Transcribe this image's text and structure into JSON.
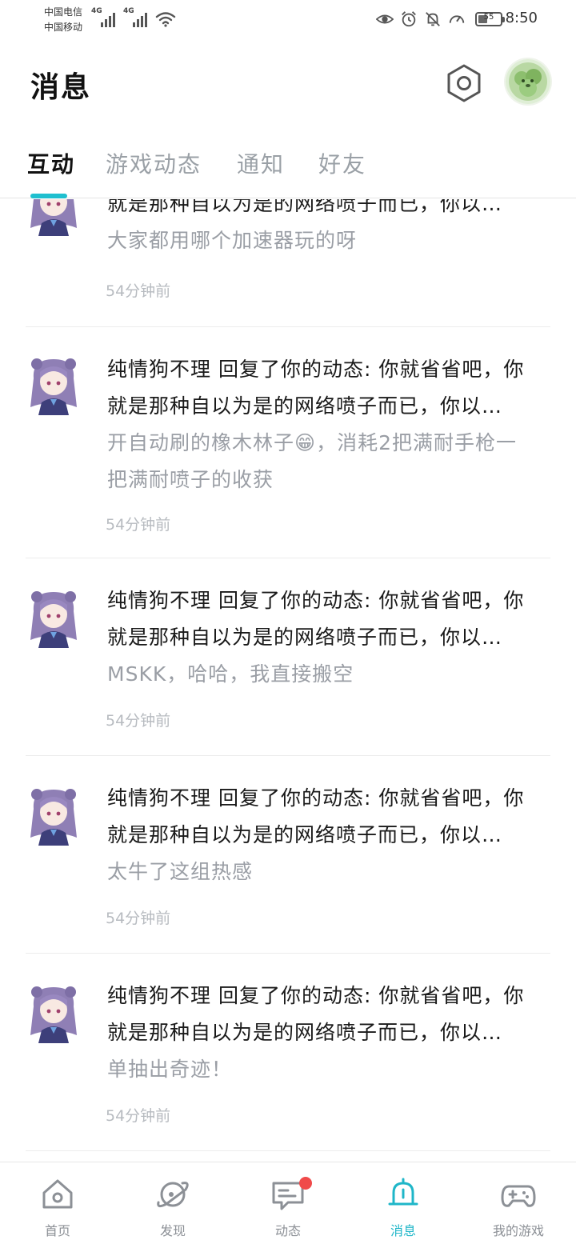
{
  "status_bar": {
    "carrier_1": "中国电信",
    "carrier_2": "中国移动",
    "network_1": "4G",
    "network_2": "4G",
    "battery_level": "55",
    "time": "8:50"
  },
  "header": {
    "title": "消息"
  },
  "tabs": [
    {
      "label": "互动",
      "active": true
    },
    {
      "label": "游戏动态",
      "active": false
    },
    {
      "label": "通知",
      "active": false
    },
    {
      "label": "好友",
      "active": false
    }
  ],
  "messages": [
    {
      "line1": "",
      "line2": "就是那种自以为是的网络喷子而已，你以…",
      "reply": [
        "大家都用哪个加速器玩的呀"
      ],
      "time": "54分钟前"
    },
    {
      "line1": "纯情狗不理 回复了你的动态: 你就省省吧，你",
      "line2": "就是那种自以为是的网络喷子而已，你以…",
      "reply": [
        "开自动刷的橡木林子😁，消耗2把满耐手枪一",
        "把满耐喷子的收获"
      ],
      "time": "54分钟前"
    },
    {
      "line1": "纯情狗不理 回复了你的动态: 你就省省吧，你",
      "line2": "就是那种自以为是的网络喷子而已，你以…",
      "reply": [
        "MSKK，哈哈，我直接搬空"
      ],
      "time": "54分钟前"
    },
    {
      "line1": "纯情狗不理 回复了你的动态: 你就省省吧，你",
      "line2": "就是那种自以为是的网络喷子而已，你以…",
      "reply": [
        "太牛了这组热感"
      ],
      "time": "54分钟前"
    },
    {
      "line1": "纯情狗不理 回复了你的动态: 你就省省吧，你",
      "line2": "就是那种自以为是的网络喷子而已，你以…",
      "reply": [
        "单抽出奇迹！"
      ],
      "time": "54分钟前"
    }
  ],
  "bottom_nav": [
    {
      "label": "首页",
      "icon": "home-icon",
      "active": false
    },
    {
      "label": "发现",
      "icon": "planet-icon",
      "active": false
    },
    {
      "label": "动态",
      "icon": "chat-icon",
      "active": false,
      "badge": true
    },
    {
      "label": "消息",
      "icon": "bell-icon",
      "active": true
    },
    {
      "label": "我的游戏",
      "icon": "gamepad-icon",
      "active": false
    }
  ],
  "colors": {
    "accent": "#1fbfcf",
    "badge": "#f04a4a",
    "muted_text": "#9a9ea5",
    "time_text": "#b7bbc0"
  }
}
